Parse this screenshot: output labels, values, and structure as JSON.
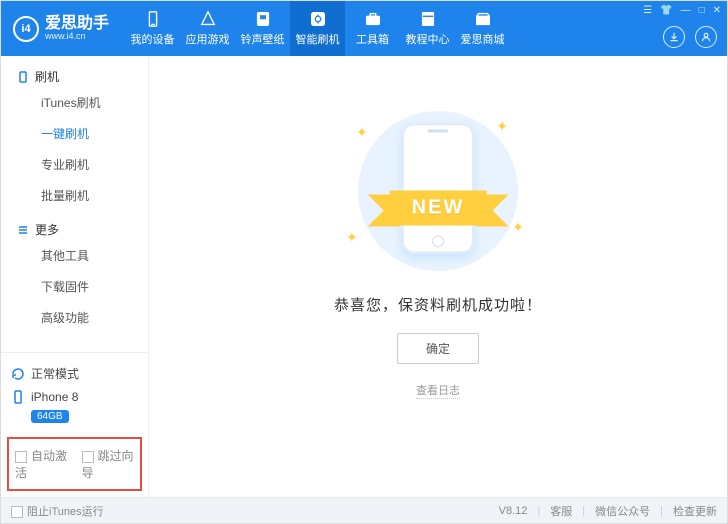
{
  "header": {
    "brand_name": "爱思助手",
    "brand_url": "www.i4.cn",
    "brand_short": "i4",
    "nav": [
      {
        "label": "我的设备",
        "icon": "device"
      },
      {
        "label": "应用游戏",
        "icon": "apps"
      },
      {
        "label": "铃声壁纸",
        "icon": "music"
      },
      {
        "label": "智能刷机",
        "icon": "flash",
        "active": true
      },
      {
        "label": "工具箱",
        "icon": "toolbox"
      },
      {
        "label": "教程中心",
        "icon": "book"
      },
      {
        "label": "爱思商城",
        "icon": "store"
      }
    ]
  },
  "sidebar": {
    "groups": [
      {
        "title": "刷机",
        "items": [
          {
            "label": "iTunes刷机"
          },
          {
            "label": "一键刷机",
            "active": true
          },
          {
            "label": "专业刷机"
          },
          {
            "label": "批量刷机"
          }
        ]
      },
      {
        "title": "更多",
        "items": [
          {
            "label": "其他工具"
          },
          {
            "label": "下载固件"
          },
          {
            "label": "高级功能"
          }
        ]
      }
    ],
    "status": {
      "mode": "正常模式",
      "device": "iPhone 8",
      "capacity": "64GB"
    },
    "options": {
      "auto_activate": "自动激活",
      "skip_wizard": "跳过向导"
    }
  },
  "main": {
    "ribbon_text": "NEW",
    "message": "恭喜您，保资料刷机成功啦！",
    "ok_label": "确定",
    "log_label": "查看日志"
  },
  "footer": {
    "block_itunes": "阻止iTunes运行",
    "version": "V8.12",
    "support": "客服",
    "wechat": "微信公众号",
    "update": "检查更新"
  }
}
